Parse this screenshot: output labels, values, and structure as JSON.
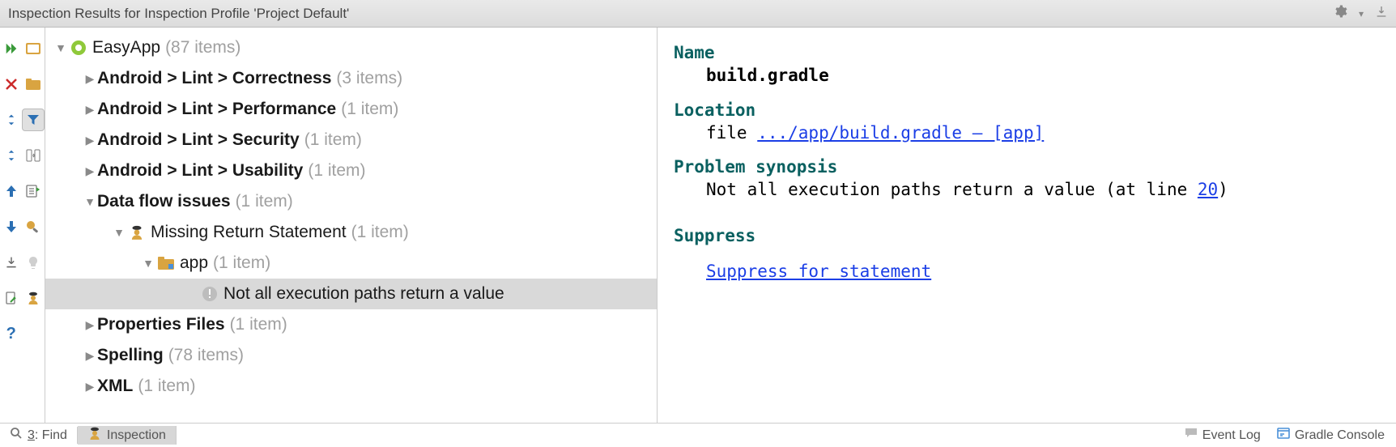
{
  "header": {
    "title": "Inspection Results for Inspection Profile 'Project Default'"
  },
  "tree": {
    "root": {
      "label": "EasyApp",
      "count": "(87 items)"
    },
    "items": [
      {
        "label": "Android > Lint > Correctness",
        "count": "(3 items)",
        "expanded": false
      },
      {
        "label": "Android > Lint > Performance",
        "count": "(1 item)",
        "expanded": false
      },
      {
        "label": "Android > Lint > Security",
        "count": "(1 item)",
        "expanded": false
      },
      {
        "label": "Android > Lint > Usability",
        "count": "(1 item)",
        "expanded": false
      },
      {
        "label": "Data flow issues",
        "count": "(1 item)",
        "expanded": true,
        "children": [
          {
            "label": "Missing Return Statement",
            "count": "(1 item)",
            "expanded": true,
            "children": [
              {
                "label": "app",
                "count": "(1 item)",
                "expanded": true,
                "children": [
                  {
                    "label": "Not all execution paths return a value",
                    "selected": true
                  }
                ]
              }
            ]
          }
        ]
      },
      {
        "label": "Properties Files",
        "count": "(1 item)",
        "expanded": false
      },
      {
        "label": "Spelling",
        "count": "(78 items)",
        "expanded": false
      },
      {
        "label": "XML",
        "count": "(1 item)",
        "expanded": false
      }
    ]
  },
  "detail": {
    "name_head": "Name",
    "name_value": "build.gradle",
    "location_head": "Location",
    "location_prefix": "file ",
    "location_link": ".../app/build.gradle – [app]",
    "synopsis_head": "Problem synopsis",
    "synopsis_text": "Not all execution paths return a value (at line ",
    "synopsis_line": "20",
    "synopsis_close": ")",
    "suppress_head": "Suppress",
    "suppress_link": "Suppress for statement"
  },
  "status": {
    "find_prefix": "3",
    "find_label": ": Find",
    "inspection": "Inspection",
    "event_log": "Event Log",
    "gradle_console": "Gradle Console"
  }
}
